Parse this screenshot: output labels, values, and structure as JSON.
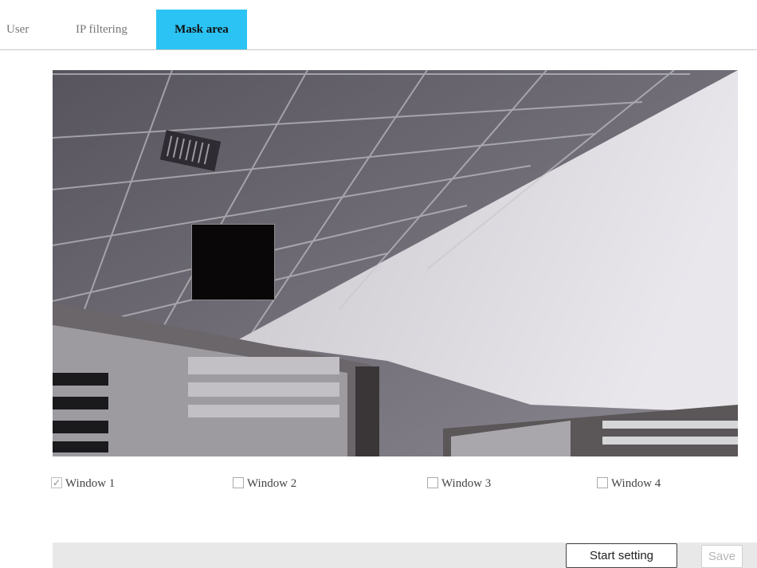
{
  "tabs": [
    {
      "label": "User",
      "active": false
    },
    {
      "label": "IP filtering",
      "active": false
    },
    {
      "label": "Mask area",
      "active": true
    }
  ],
  "colors": {
    "active_tab": "#2bc3f3",
    "mask": "#0a0709",
    "footer_bar": "#e8e8e8"
  },
  "windows": [
    {
      "label": "Window 1",
      "checked": true
    },
    {
      "label": "Window 2",
      "checked": false
    },
    {
      "label": "Window 3",
      "checked": false
    },
    {
      "label": "Window 4",
      "checked": false
    }
  ],
  "buttons": {
    "start_setting": "Start setting",
    "save": "Save"
  }
}
